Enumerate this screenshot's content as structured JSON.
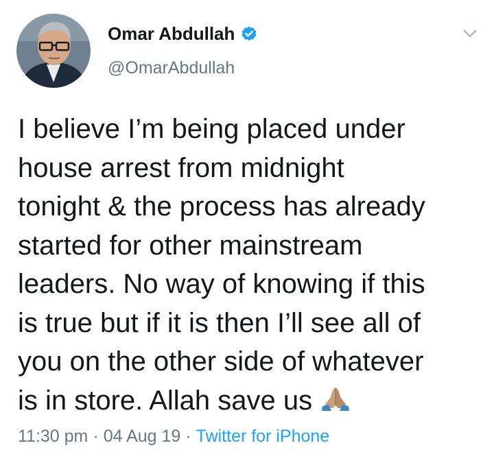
{
  "author": {
    "name": "Omar Abdullah",
    "handle": "@OmarAbdullah",
    "verified": true,
    "verified_color": "#1da1f2"
  },
  "tweet": {
    "text_lines": [
      "I believe I’m being placed under",
      "house arrest from midnight",
      "tonight & the process has already",
      "started for other mainstream",
      "leaders. No way of knowing if this",
      "is true but if it is then I’ll see all of",
      "you on the other side of whatever",
      "is in store. Allah save us"
    ],
    "emoji": "folded-hands-emoji"
  },
  "meta": {
    "time": "11:30 pm",
    "separator": "·",
    "date": "04 Aug 19",
    "source": "Twitter for iPhone"
  },
  "icons": {
    "menu": "chevron-down-icon",
    "verified": "verified-badge-icon"
  },
  "colors": {
    "text": "#14171a",
    "secondary": "#657786",
    "link": "#1da1f2"
  }
}
